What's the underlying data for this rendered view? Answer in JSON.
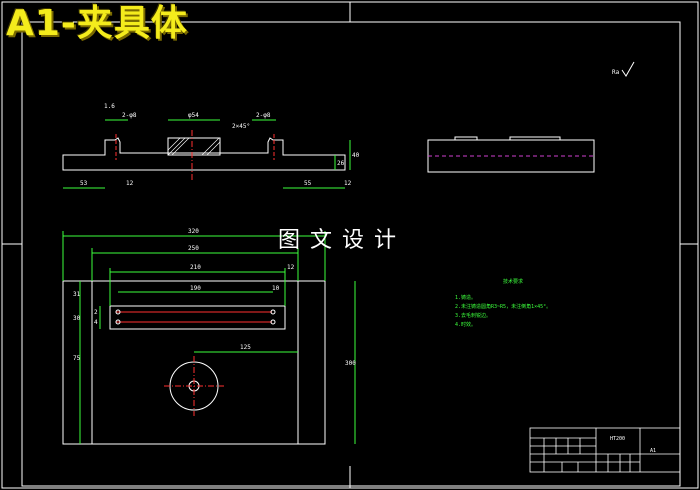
{
  "sheet": {
    "title": "A1-夹具体",
    "watermark": "图文设计"
  },
  "top_view": {
    "dims": {
      "left_width": "53",
      "right_width": "55",
      "center_bore": "φ54",
      "hole_left": "2-φ8",
      "hole_right": "2-φ8",
      "height_a": "26",
      "height_b": "40",
      "chamfer": "2×45°",
      "small": "1.6",
      "left_h": "14",
      "angle_left": "12",
      "angle_right": "12"
    }
  },
  "plan_view": {
    "dims": {
      "overall": "320",
      "inner": "250",
      "slot_len": "210",
      "slot_inner": "190",
      "offset_right": "12",
      "offset_right2": "10",
      "offset_center": "125",
      "side_a": "31",
      "side_b": "30",
      "side_c": "2",
      "side_d": "4",
      "side_e": "75",
      "height_total": "300"
    }
  },
  "notes": {
    "heading": "技术要求",
    "lines": [
      "1.铸造。",
      "2.未注铸造圆角R3~R5，未注倒角1×45°。",
      "3.去毛刺锐边。",
      "4.时效。"
    ]
  },
  "title_block": {
    "material": "HT200",
    "part_name": "A1"
  },
  "roughness": {
    "label": "Ra"
  }
}
